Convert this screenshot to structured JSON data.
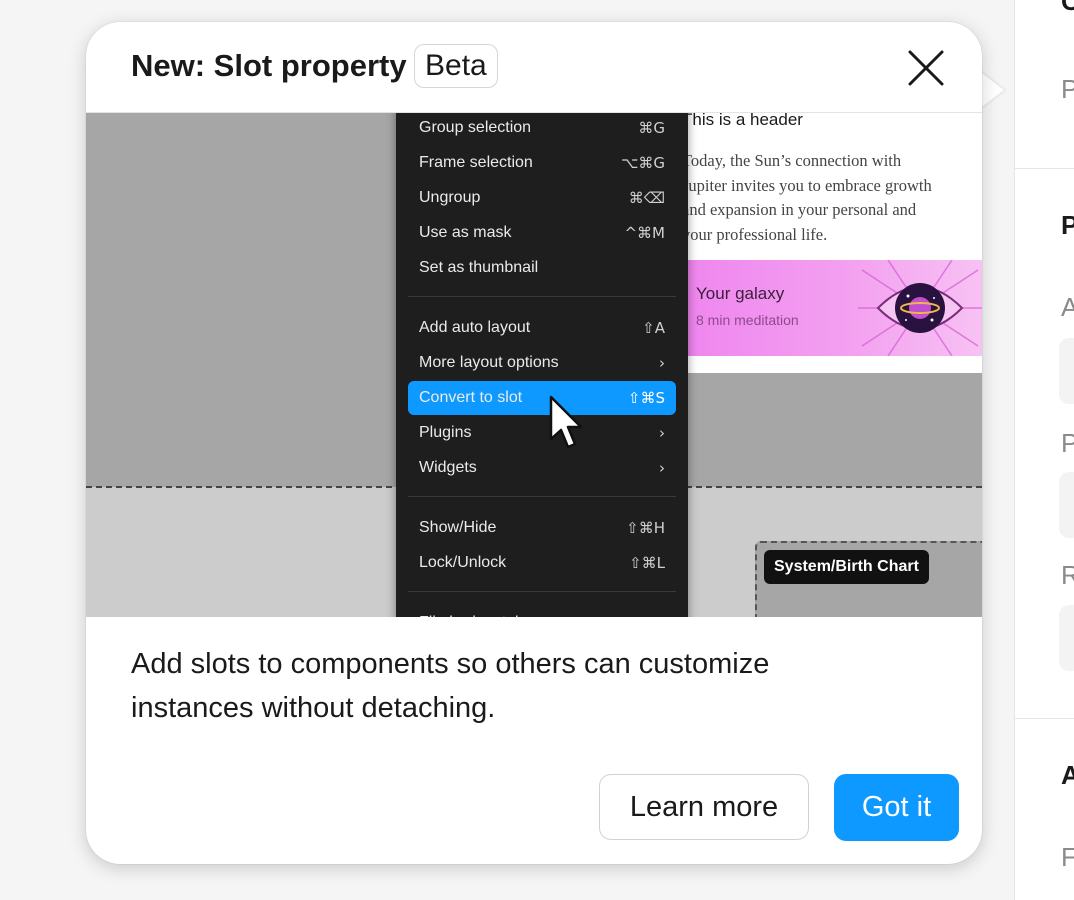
{
  "popover": {
    "title": "New: Slot property",
    "badge": "Beta",
    "description_lines": [
      "Add slots to components so others can customize",
      "instances without detaching."
    ],
    "learn_more_label": "Learn more",
    "got_it_label": "Got it"
  },
  "preview": {
    "context_menu": [
      {
        "label": "Group selection",
        "shortcut": "⌘G"
      },
      {
        "label": "Frame selection",
        "shortcut": "⌥⌘G"
      },
      {
        "label": "Ungroup",
        "shortcut": "⌘⌫"
      },
      {
        "label": "Use as mask",
        "shortcut": "^⌘M"
      },
      {
        "label": "Set as thumbnail",
        "shortcut": ""
      },
      {
        "label": "Add auto layout",
        "shortcut": "⇧A"
      },
      {
        "label": "More layout options",
        "shortcut": "›"
      },
      {
        "label": "Convert to slot",
        "shortcut": "⇧⌘S"
      },
      {
        "label": "Plugins",
        "shortcut": "›"
      },
      {
        "label": "Widgets",
        "shortcut": "›"
      },
      {
        "label": "Show/Hide",
        "shortcut": "⇧⌘H"
      },
      {
        "label": "Lock/Unlock",
        "shortcut": "⇧⌘L"
      },
      {
        "label": "Flip horizontal",
        "shortcut": "⇧H"
      }
    ],
    "card": {
      "header": "This is a header",
      "body_lines": [
        "Today, the Sun’s connection with",
        "Jupiter invites you to embrace growth",
        "and expansion in your personal and",
        "your professional life."
      ],
      "galaxy_title": "Your galaxy",
      "galaxy_subtitle": "8 min meditation"
    },
    "frame_tag": "System/Birth Chart"
  },
  "side_panel": {
    "labels": [
      "C",
      "P",
      "P",
      "A",
      "P",
      "R",
      "A",
      "F"
    ]
  },
  "colors": {
    "accent": "#0d99ff",
    "menu_bg": "#1e1e1e",
    "galaxy_pink": "#ef86ef"
  },
  "icons": {
    "close": "close-icon",
    "cursor": "pointer-cursor-icon",
    "eye": "galaxy-eye-icon"
  }
}
